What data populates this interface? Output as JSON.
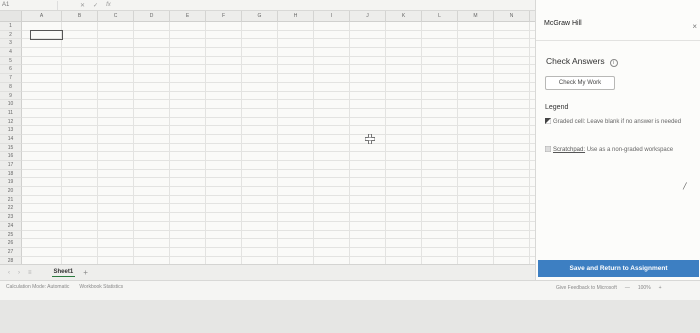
{
  "formula_bar": {
    "name_box": "A1",
    "icons": [
      "x-icon",
      "check-icon",
      "fx-icon"
    ]
  },
  "grid": {
    "columns": [
      "A",
      "B",
      "C",
      "D",
      "E",
      "F",
      "G",
      "H",
      "I",
      "J",
      "K",
      "L",
      "M",
      "N",
      "O",
      "P"
    ],
    "rows": [
      "1",
      "2",
      "3",
      "4",
      "5",
      "6",
      "7",
      "8",
      "9",
      "10",
      "11",
      "12",
      "13",
      "14",
      "15",
      "16",
      "17",
      "18",
      "19",
      "20",
      "21",
      "22",
      "23",
      "24",
      "25",
      "26",
      "27",
      "28"
    ]
  },
  "tabs": {
    "sheet_label": "Sheet1",
    "add_label": "+"
  },
  "status_bar": {
    "left": [
      "Calculation Mode: Automatic",
      "Workbook Statistics"
    ],
    "feedback": "Give Feedback to Microsoft",
    "zoom": "100%"
  },
  "side_panel": {
    "brand": "McGraw Hill",
    "close": "×",
    "check_title": "Check Answers",
    "info": "i",
    "check_button": "Check My Work",
    "legend_title": "Legend",
    "legend_graded": "Graded cell: Leave blank if no answer is needed",
    "legend_scratch_link": "Scratchpad:",
    "legend_scratch": "Use as a non-graded workspace",
    "save_button": "Save and Return to Assignment"
  },
  "colors": {
    "accent": "#3d7fc2",
    "sheet_tab_underline": "#2b7a3e"
  }
}
